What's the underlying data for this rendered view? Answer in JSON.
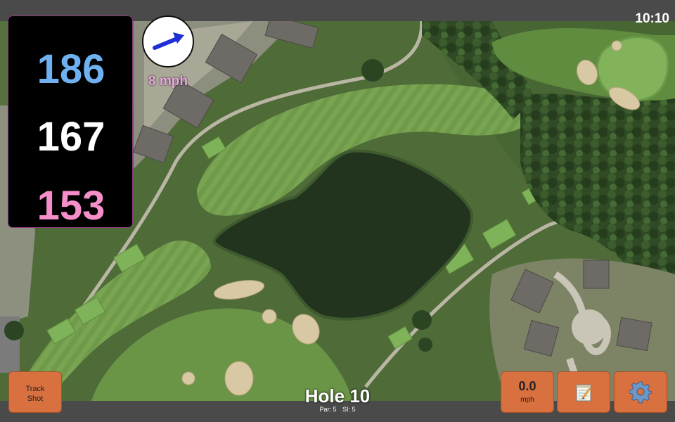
{
  "status_bar": {
    "clock": "10:10"
  },
  "distances": {
    "back": "186",
    "middle": "167",
    "front": "153"
  },
  "wind": {
    "speed": "8 mph",
    "icon": "arrow-right-icon"
  },
  "buttons": {
    "track_shot": "Track\nShot",
    "speed_value": "0.0",
    "speed_unit": "mph",
    "notes_icon": "notepad-icon",
    "settings_icon": "gear-icon"
  },
  "hole": {
    "title": "Hole 10",
    "par": "Par: 5",
    "si": "SI: 5"
  },
  "colors": {
    "back_distance": "#6fb0f0",
    "middle_distance": "#ffffff",
    "front_distance": "#f58fc9",
    "button": "#d9703f",
    "wind_text": "#e7a8df"
  }
}
